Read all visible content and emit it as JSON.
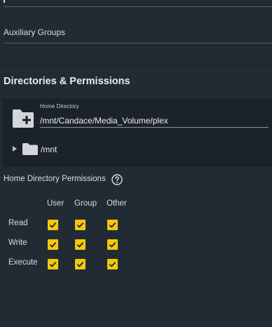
{
  "auxiliary_groups": {
    "label": "Auxiliary Groups"
  },
  "directories_section": {
    "title": "Directories & Permissions",
    "home_directory": {
      "label": "Home Directory",
      "value": "/mnt/Candace/Media_Volume/plex"
    },
    "tree": {
      "root_label": "/mnt"
    }
  },
  "permissions": {
    "title": "Home Directory Permissions",
    "columns": [
      "User",
      "Group",
      "Other"
    ],
    "rows": [
      {
        "label": "Read",
        "user": true,
        "group": true,
        "other": true
      },
      {
        "label": "Write",
        "user": true,
        "group": true,
        "other": true
      },
      {
        "label": "Execute",
        "user": true,
        "group": true,
        "other": true
      }
    ]
  },
  "colors": {
    "background": "#222b33",
    "panel": "#1b2229",
    "checkbox": "#f2c90f"
  },
  "icons": {
    "home_dir": "folder-plus-icon",
    "tree_folder": "folder-icon",
    "expander": "chevron-right-icon",
    "help": "help-icon"
  }
}
